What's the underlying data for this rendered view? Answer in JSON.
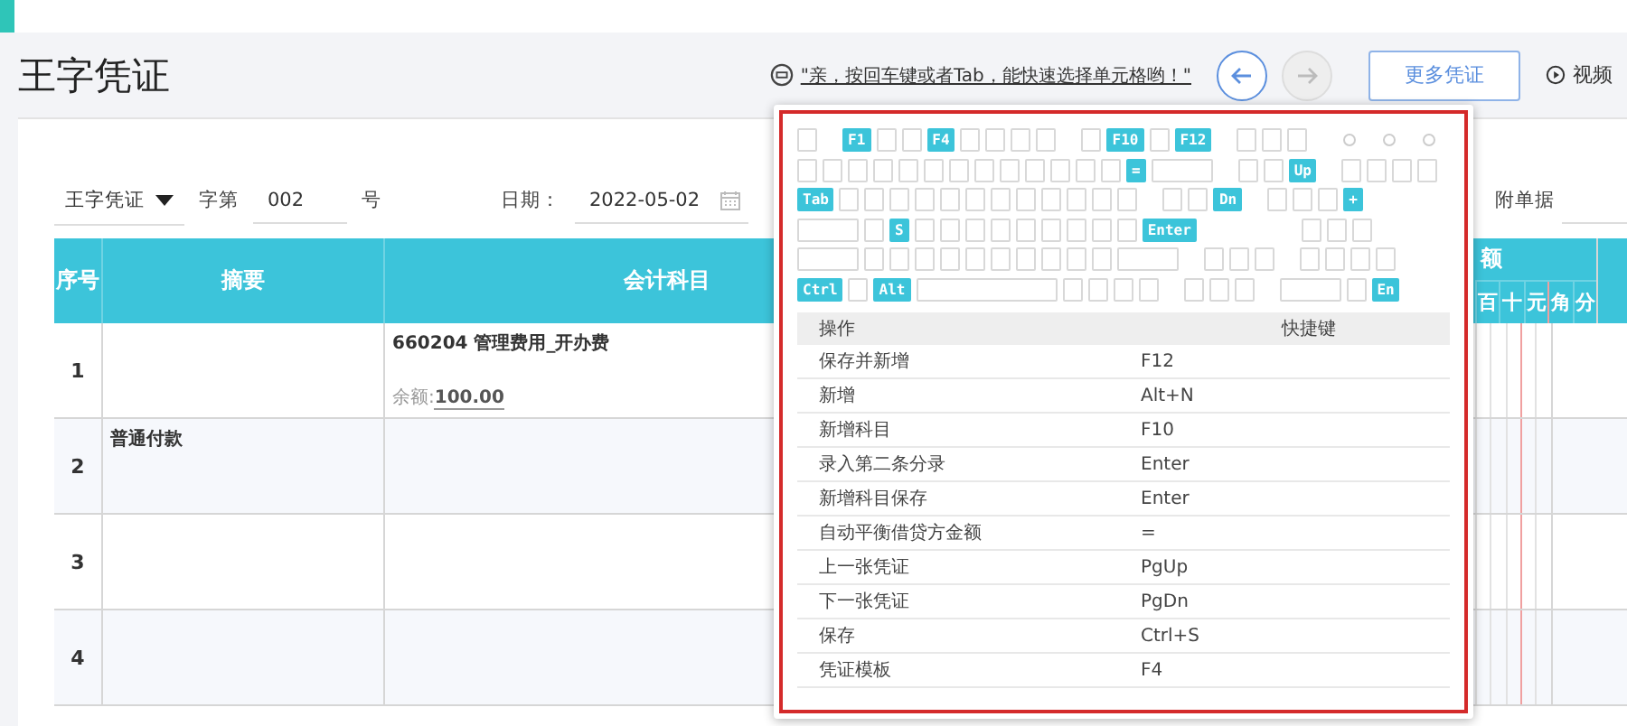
{
  "title": "王字凭证",
  "toolbar": {
    "hint": "\"亲，按回车键或者Tab，能快速选择单元格哟！\"",
    "prev": {
      "disabled": false
    },
    "next": {
      "disabled": true
    },
    "more_button": "更多凭证",
    "video_link": "视频"
  },
  "form": {
    "voucher_type": "王字凭证",
    "number_prefix": "字第",
    "number": "002",
    "number_suffix": "号",
    "date_label": "日期：",
    "date": "2022-05-02",
    "attachments_label": "附单据"
  },
  "table": {
    "columns": [
      "序号",
      "摘要",
      "会计科目"
    ],
    "amount_header": "额",
    "amount_digits": [
      "百",
      "十",
      "元",
      "角",
      "分"
    ],
    "rows": [
      {
        "index": "1",
        "subject": "660204 管理费用_开办费",
        "balance_label": "余额:",
        "balance": "100.00"
      },
      {
        "index": "2",
        "summary": "普通付款"
      },
      {
        "index": "3"
      },
      {
        "index": "4"
      }
    ]
  },
  "shortcut_popup": {
    "keyboard": [
      [
        {
          "kind": "blank"
        },
        {
          "kind": "gap"
        },
        {
          "kind": "key",
          "label": "F1"
        },
        {
          "kind": "blank"
        },
        {
          "kind": "blank"
        },
        {
          "kind": "key",
          "label": "F4"
        },
        {
          "kind": "blank"
        },
        {
          "kind": "blank"
        },
        {
          "kind": "blank"
        },
        {
          "kind": "blank"
        },
        {
          "kind": "gap"
        },
        {
          "kind": "blank"
        },
        {
          "kind": "key",
          "label": "F10"
        },
        {
          "kind": "blank"
        },
        {
          "kind": "key",
          "label": "F12"
        },
        {
          "kind": "gap"
        },
        {
          "kind": "blank"
        },
        {
          "kind": "blank"
        },
        {
          "kind": "blank"
        },
        {
          "kind": "gap"
        },
        {
          "kind": "dot"
        },
        {
          "kind": "dot"
        },
        {
          "kind": "dot"
        }
      ],
      [
        {
          "kind": "blank"
        },
        {
          "kind": "blank"
        },
        {
          "kind": "blank"
        },
        {
          "kind": "blank"
        },
        {
          "kind": "blank"
        },
        {
          "kind": "blank"
        },
        {
          "kind": "blank"
        },
        {
          "kind": "blank"
        },
        {
          "kind": "blank"
        },
        {
          "kind": "blank"
        },
        {
          "kind": "blank"
        },
        {
          "kind": "blank"
        },
        {
          "kind": "blank"
        },
        {
          "kind": "key",
          "label": "="
        },
        {
          "kind": "wide"
        },
        {
          "kind": "gap"
        },
        {
          "kind": "blank"
        },
        {
          "kind": "blank"
        },
        {
          "kind": "key",
          "label": "Up"
        },
        {
          "kind": "gap"
        },
        {
          "kind": "blank"
        },
        {
          "kind": "blank"
        },
        {
          "kind": "blank"
        },
        {
          "kind": "blank"
        }
      ],
      [
        {
          "kind": "key",
          "label": "Tab"
        },
        {
          "kind": "blank"
        },
        {
          "kind": "blank"
        },
        {
          "kind": "blank"
        },
        {
          "kind": "blank"
        },
        {
          "kind": "blank"
        },
        {
          "kind": "blank"
        },
        {
          "kind": "blank"
        },
        {
          "kind": "blank"
        },
        {
          "kind": "blank"
        },
        {
          "kind": "blank"
        },
        {
          "kind": "blank"
        },
        {
          "kind": "blank"
        },
        {
          "kind": "gap"
        },
        {
          "kind": "blank"
        },
        {
          "kind": "blank"
        },
        {
          "kind": "key",
          "label": "Dn"
        },
        {
          "kind": "gap"
        },
        {
          "kind": "blank"
        },
        {
          "kind": "blank"
        },
        {
          "kind": "blank"
        },
        {
          "kind": "key",
          "label": "+"
        }
      ],
      [
        {
          "kind": "wide"
        },
        {
          "kind": "blank"
        },
        {
          "kind": "key",
          "label": "S"
        },
        {
          "kind": "blank"
        },
        {
          "kind": "blank"
        },
        {
          "kind": "blank"
        },
        {
          "kind": "blank"
        },
        {
          "kind": "blank"
        },
        {
          "kind": "blank"
        },
        {
          "kind": "blank"
        },
        {
          "kind": "blank"
        },
        {
          "kind": "blank"
        },
        {
          "kind": "key",
          "label": "Enter"
        },
        {
          "kind": "gap"
        },
        {
          "kind": "gap"
        },
        {
          "kind": "gap"
        },
        {
          "kind": "gap"
        },
        {
          "kind": "gap"
        },
        {
          "kind": "blank"
        },
        {
          "kind": "blank"
        },
        {
          "kind": "blank"
        }
      ],
      [
        {
          "kind": "wide"
        },
        {
          "kind": "blank"
        },
        {
          "kind": "blank"
        },
        {
          "kind": "blank"
        },
        {
          "kind": "blank"
        },
        {
          "kind": "blank"
        },
        {
          "kind": "blank"
        },
        {
          "kind": "blank"
        },
        {
          "kind": "blank"
        },
        {
          "kind": "blank"
        },
        {
          "kind": "blank"
        },
        {
          "kind": "wide"
        },
        {
          "kind": "gap"
        },
        {
          "kind": "blank"
        },
        {
          "kind": "blank"
        },
        {
          "kind": "blank"
        },
        {
          "kind": "gap"
        },
        {
          "kind": "blank"
        },
        {
          "kind": "blank"
        },
        {
          "kind": "blank"
        },
        {
          "kind": "blank"
        }
      ],
      [
        {
          "kind": "key",
          "label": "Ctrl"
        },
        {
          "kind": "blank"
        },
        {
          "kind": "key",
          "label": "Alt"
        },
        {
          "kind": "space"
        },
        {
          "kind": "blank"
        },
        {
          "kind": "blank"
        },
        {
          "kind": "blank"
        },
        {
          "kind": "blank"
        },
        {
          "kind": "gap"
        },
        {
          "kind": "blank"
        },
        {
          "kind": "blank"
        },
        {
          "kind": "blank"
        },
        {
          "kind": "gap"
        },
        {
          "kind": "wide"
        },
        {
          "kind": "blank"
        },
        {
          "kind": "key",
          "label": "En"
        }
      ]
    ],
    "columns": [
      "操作",
      "快捷键"
    ],
    "rows": [
      {
        "action": "保存并新增",
        "key": "F12"
      },
      {
        "action": "新增",
        "key": "Alt+N"
      },
      {
        "action": "新增科目",
        "key": "F10"
      },
      {
        "action": "录入第二条分录",
        "key": "Enter"
      },
      {
        "action": "新增科目保存",
        "key": "Enter"
      },
      {
        "action": "自动平衡借贷方金额",
        "key": "="
      },
      {
        "action": "上一张凭证",
        "key": "PgUp"
      },
      {
        "action": "下一张凭证",
        "key": "PgDn"
      },
      {
        "action": "保存",
        "key": "Ctrl+S"
      },
      {
        "action": "凭证模板",
        "key": "F4"
      }
    ]
  }
}
